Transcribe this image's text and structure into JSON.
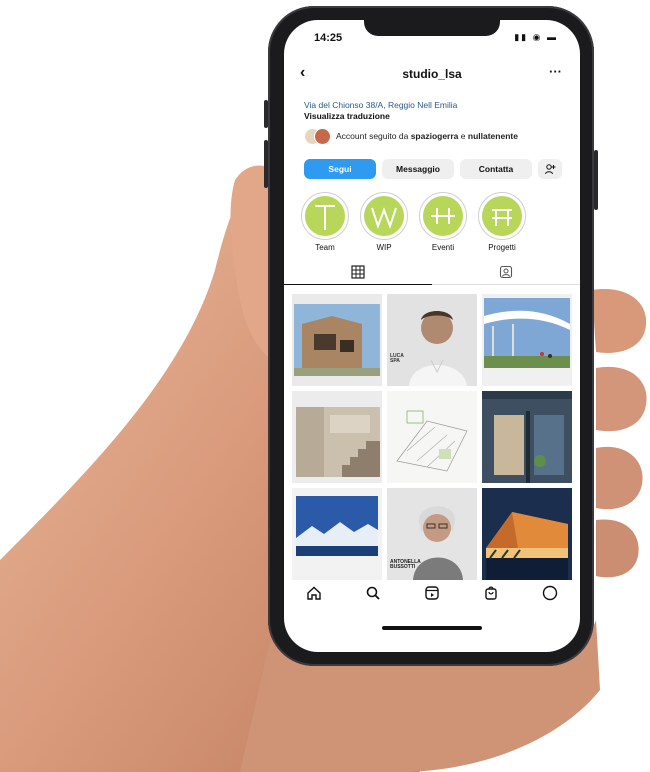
{
  "status": {
    "time": "14:25",
    "icons": "▮▮ ◉ ▬"
  },
  "profile": {
    "username": "studio_lsa",
    "address": "Via del Chionso 38/A, Reggio Nell Emilia",
    "translate_label": "Visualizza traduzione",
    "followed_prefix": "Account seguito da",
    "followed_user1": "spaziogerra",
    "followed_and": "e",
    "followed_user2": "nullatenente"
  },
  "buttons": {
    "follow": "Segui",
    "message": "Messaggio",
    "contact": "Contatta",
    "add_person": "➕"
  },
  "highlights": [
    {
      "label": "Team"
    },
    {
      "label": "WIP"
    },
    {
      "label": "Eventi"
    },
    {
      "label": "Progetti"
    }
  ],
  "tabs": {
    "grid": "▦",
    "tagged": "⧉"
  },
  "nav": {
    "home": "home-icon",
    "search": "search-icon",
    "reels": "reels-icon",
    "shop": "shop-icon",
    "profile": "profile-icon"
  },
  "grid_posts": [
    {
      "kind": "architecture-wood-house",
      "caption": ""
    },
    {
      "kind": "portrait-man",
      "caption": "LUCA SPA"
    },
    {
      "kind": "architecture-canopy",
      "caption": ""
    },
    {
      "kind": "interior-stair",
      "caption": ""
    },
    {
      "kind": "sketch-drawing",
      "caption": ""
    },
    {
      "kind": "glass-facade-night",
      "caption": ""
    },
    {
      "kind": "mountains",
      "caption": ""
    },
    {
      "kind": "portrait-woman",
      "caption": "ANTONELLA BUSSOTTI"
    },
    {
      "kind": "pavilion-night",
      "caption": ""
    }
  ],
  "colors": {
    "follow_blue": "#2f9bf0",
    "highlight_green": "#b7d65a",
    "address_blue": "#2b5a8a"
  }
}
